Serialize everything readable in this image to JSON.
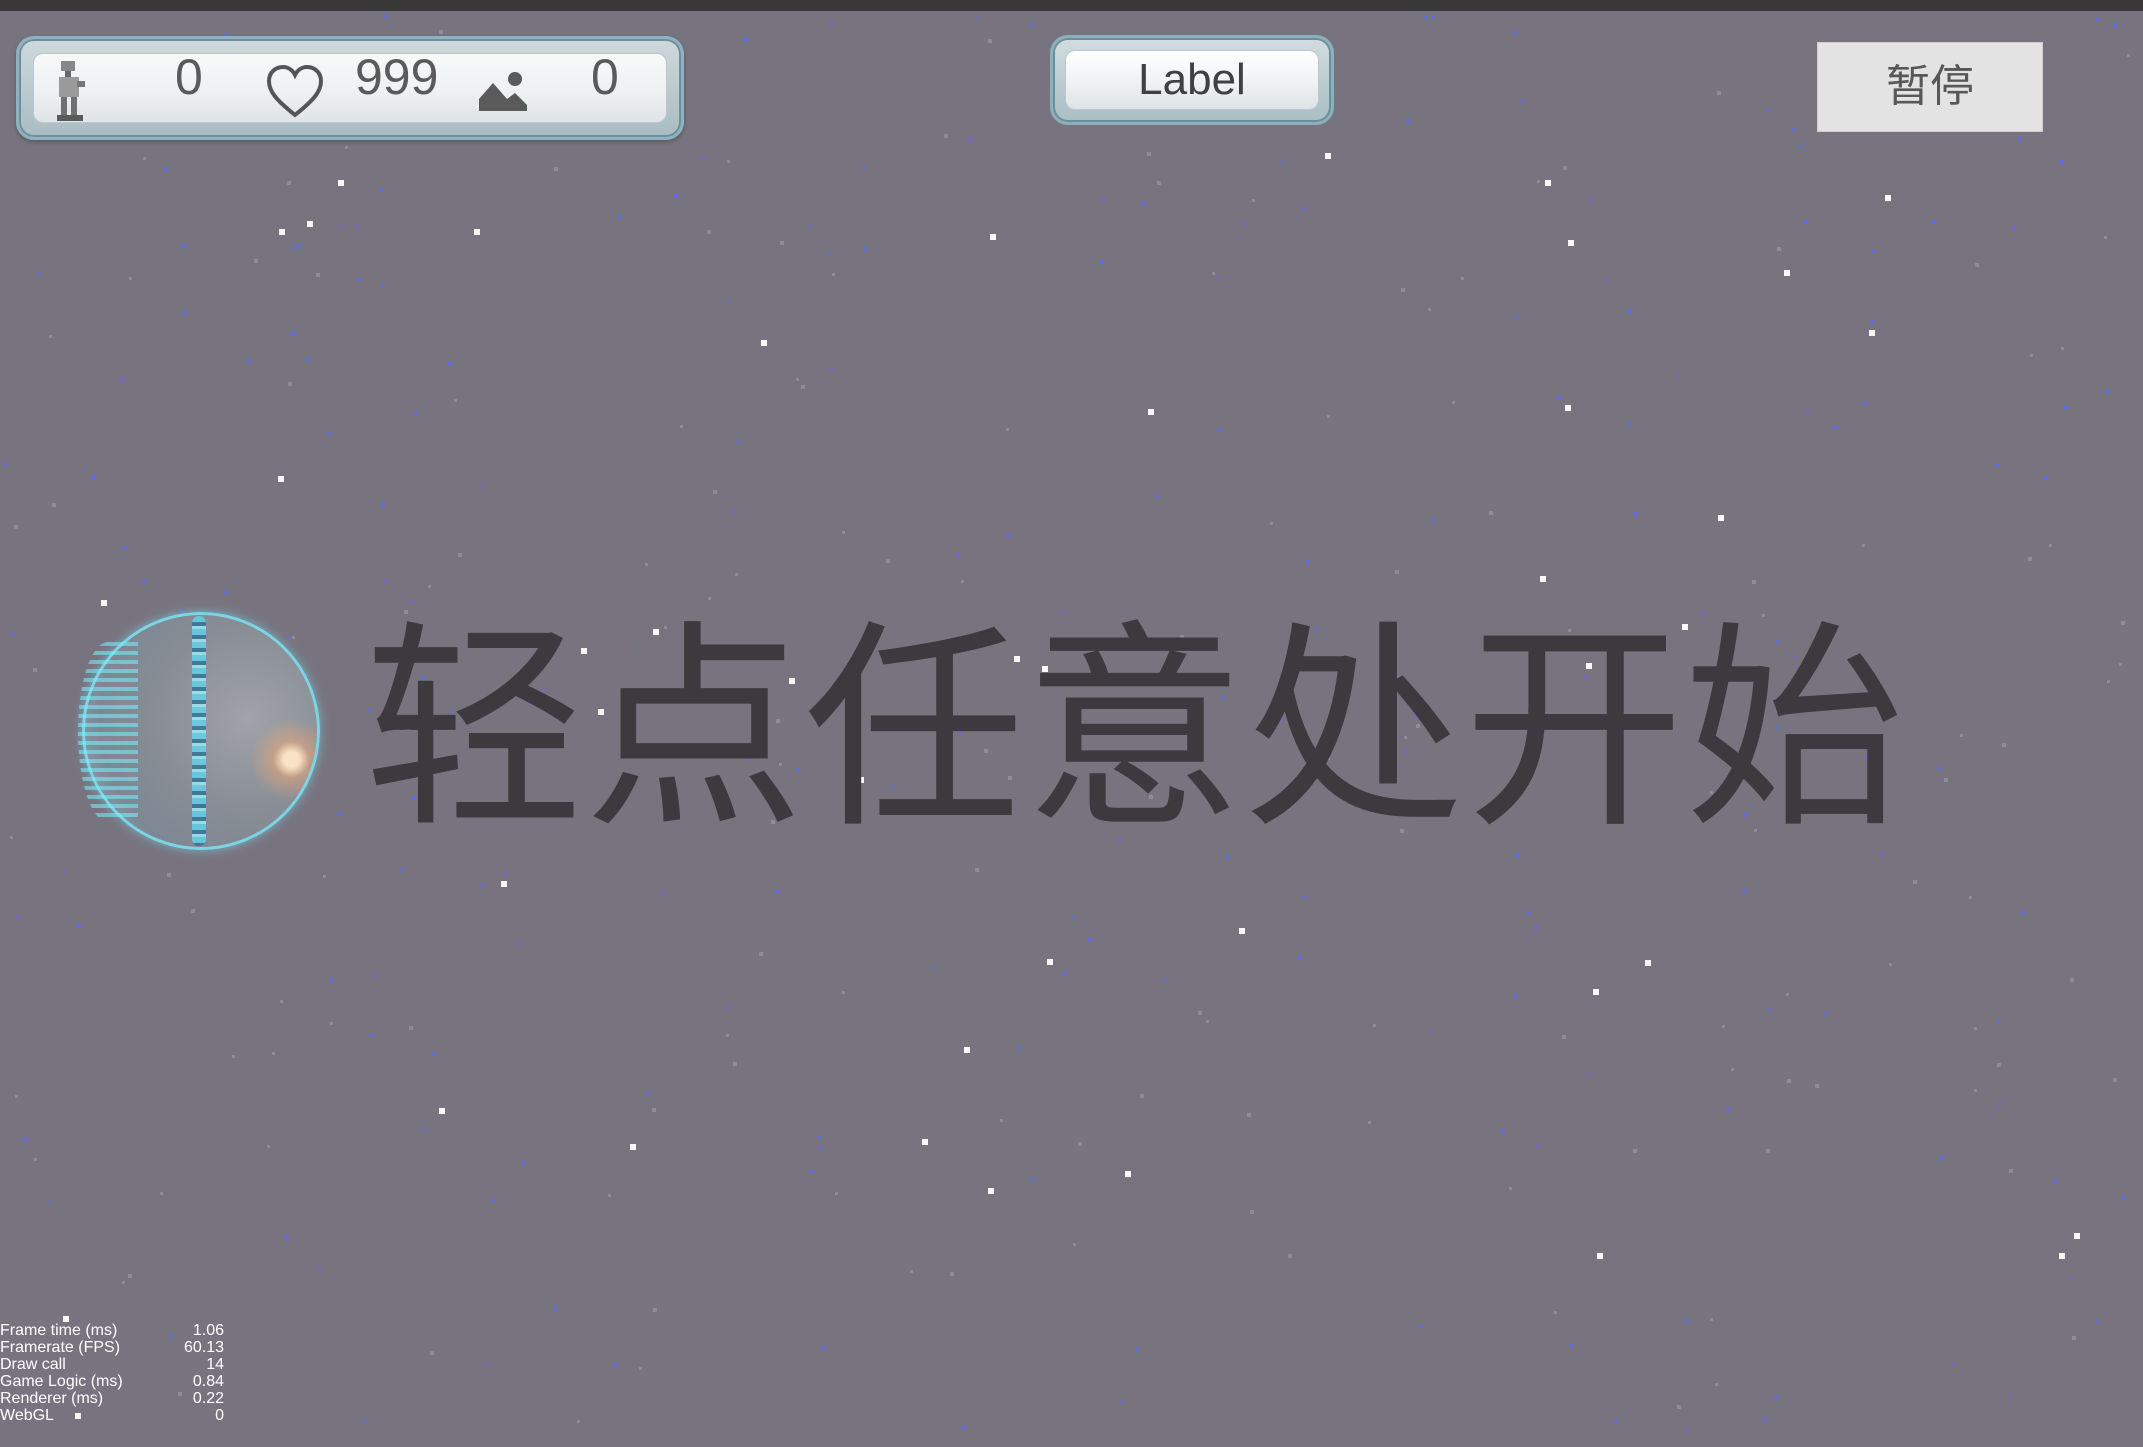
{
  "hud": {
    "robot_icon": "robot-icon",
    "score": "0",
    "heart_icon": "heart-icon",
    "lives": "999",
    "scene_icon": "mountain-icon",
    "scenes": "0"
  },
  "label_button": "Label",
  "pause_button": "暂停",
  "tap_to_start": "轻点任意处开始",
  "stats": [
    {
      "label": "Frame time (ms)",
      "value": "1.06"
    },
    {
      "label": "Framerate (FPS)",
      "value": "60.13"
    },
    {
      "label": "Draw call",
      "value": "14"
    },
    {
      "label": "Game Logic (ms)",
      "value": "0.84"
    },
    {
      "label": "Renderer (ms)",
      "value": "0.22"
    },
    {
      "label": "WebGL",
      "value": "0"
    }
  ],
  "colors": {
    "background": "#78747f",
    "panel_border": "#8fb2bf",
    "text_dark": "#3c3a3f",
    "star_white": "#ffffff",
    "star_blue": "#5a6cff"
  }
}
